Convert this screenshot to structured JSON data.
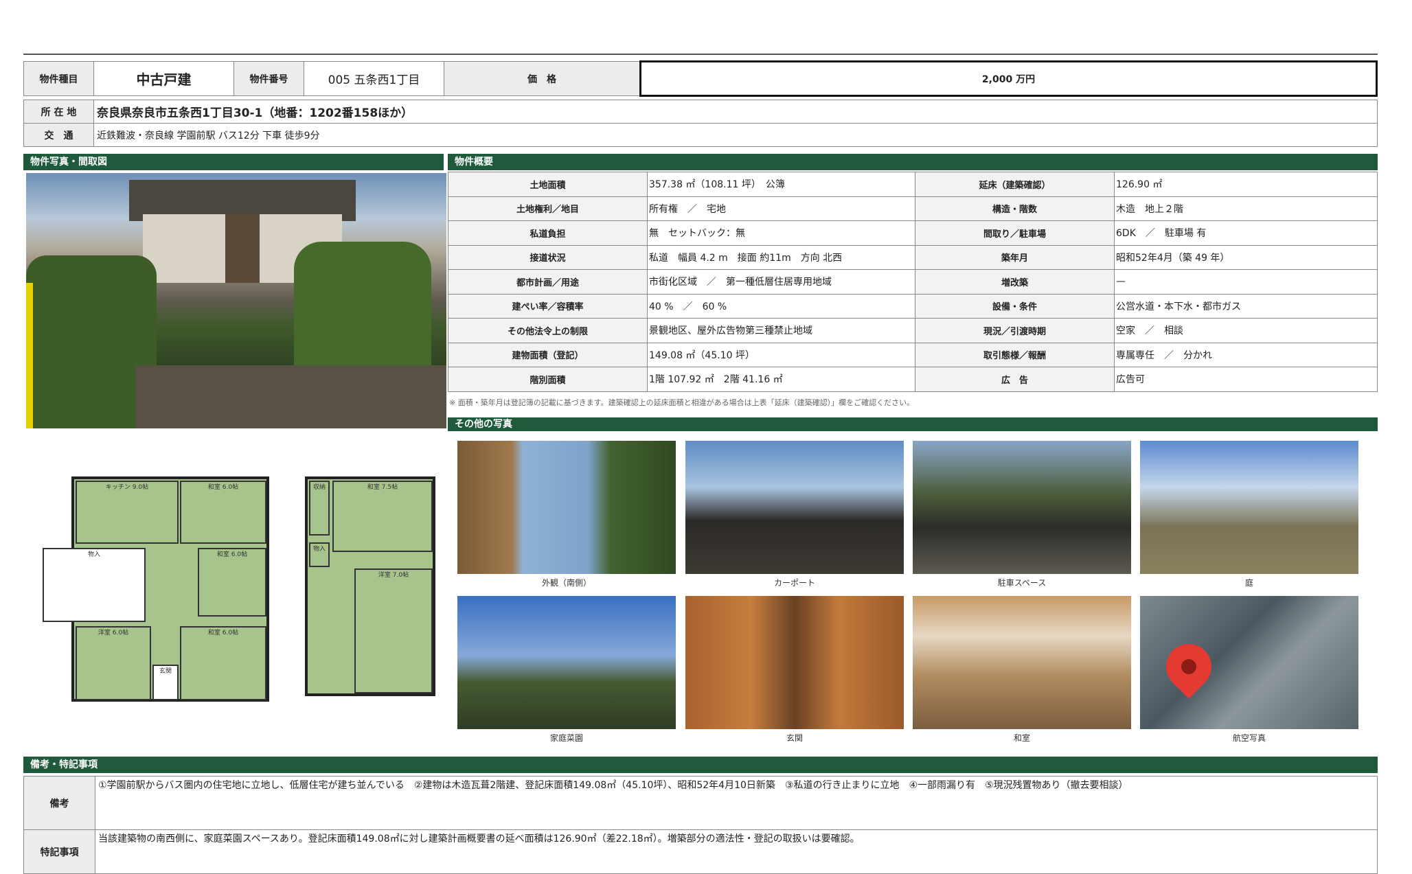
{
  "header": {
    "type_label": "物件種目",
    "type_value": "中古戸建",
    "number_label": "物件番号",
    "number_value": "005 五条西1丁目",
    "price_label": "価　格",
    "price_value": "2,000 万円"
  },
  "address": {
    "location_label": "所 在 地",
    "location_value": "奈良県奈良市五条西1丁目30-1（地番：1202番158ほか）",
    "access_label": "交　通",
    "access_value": "近鉄難波・奈良線 学園前駅 バス12分 下車 徒歩9分"
  },
  "sections": {
    "photos_title": "物件写真・間取図",
    "overview_title": "物件概要",
    "other_photos_title": "その他の写真",
    "remarks_title": "備考・特記事項"
  },
  "overview": {
    "rows": [
      {
        "l1": "土地面積",
        "v1": "357.38 ㎡（108.11 坪）　公簿",
        "l2": "延床（建築確認）",
        "v2": "126.90 ㎡"
      },
      {
        "l1": "土地権利／地目",
        "v1": "所有権　／　宅地",
        "l2": "構造・階数",
        "v2": "木造　地上２階"
      },
      {
        "l1": "私道負担",
        "v1": "無　セットバック：無",
        "l2": "間取り／駐車場",
        "v2": "6DK　／　駐車場 有"
      },
      {
        "l1": "接道状況",
        "v1": "私道　幅員 4.2 m　接面 約11m　方向 北西",
        "l2": "築年月",
        "v2": "昭和52年4月（築 49 年）"
      },
      {
        "l1": "都市計画／用途",
        "v1": "市街化区域　／　第一種低層住居専用地域",
        "l2": "増改築",
        "v2": "—"
      },
      {
        "l1": "建ぺい率／容積率",
        "v1": "40 %　／　60 %",
        "l2": "設備・条件",
        "v2": "公営水道・本下水・都市ガス"
      },
      {
        "l1": "その他法令上の制限",
        "v1": "景観地区、屋外広告物第三種禁止地域",
        "l2": "現況／引渡時期",
        "v2": "空家　／　相談"
      },
      {
        "l1": "建物面積（登記）",
        "v1": "149.08 ㎡（45.10 坪）",
        "l2": "取引態様／報酬",
        "v2": "専属専任　／　分かれ"
      },
      {
        "l1": "階別面積",
        "v1": "1階 107.92 ㎡　2階 41.16 ㎡",
        "l2": "広　告",
        "v2": "広告可"
      }
    ],
    "note": "※ 面積・築年月は登記簿の記載に基づきます。建築確認上の延床面積と相違がある場合は上表「延床（建築確認）」欄をご確認ください。"
  },
  "photos": [
    {
      "caption": "外観（南側）"
    },
    {
      "caption": "カーポート"
    },
    {
      "caption": "駐車スペース"
    },
    {
      "caption": "庭"
    },
    {
      "caption": "家庭菜園"
    },
    {
      "caption": "玄関"
    },
    {
      "caption": "和室"
    },
    {
      "caption": "航空写真"
    }
  ],
  "floorplan": {
    "rooms1": [
      "キッチン 9.0帖",
      "和室 6.0帖",
      "和室 6.0帖",
      "洋室 6.0帖",
      "和室 6.0帖",
      "玄関",
      "物入"
    ],
    "rooms2": [
      "和室 7.5帖",
      "洋室 7.0帖",
      "収納",
      "物入"
    ]
  },
  "remarks": {
    "biko_label": "備考",
    "biko_text": "①学園前駅からバス圏内の住宅地に立地し、低層住宅が建ち並んでいる　②建物は木造瓦葺2階建、登記床面積149.08㎡（45.10坪）、昭和52年4月10日新築　③私道の行き止まりに立地　④一部雨漏り有　⑤現況残置物あり（撤去要相談）",
    "special_label": "特記事項",
    "special_text": "当該建築物の南西側に、家庭菜園スペースあり。登記床面積149.08㎡に対し建築計画概要書の延べ面積は126.90㎡（差22.18㎡）。増築部分の適法性・登記の取扱いは要確認。"
  }
}
